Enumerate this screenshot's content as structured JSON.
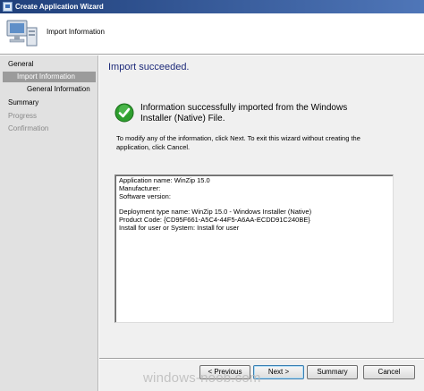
{
  "window": {
    "title": "Create Application Wizard"
  },
  "header": {
    "title": "Import Information"
  },
  "sidebar": {
    "items": [
      {
        "label": "General",
        "state": "normal"
      },
      {
        "label": "Import Information",
        "state": "selected"
      },
      {
        "label": "General Information",
        "state": "normal"
      },
      {
        "label": "Summary",
        "state": "normal"
      },
      {
        "label": "Progress",
        "state": "disabled"
      },
      {
        "label": "Confirmation",
        "state": "disabled"
      }
    ]
  },
  "main": {
    "status_title": "Import succeeded.",
    "success_line1": "Information successfully imported from the Windows",
    "success_line2": "Installer (Native) File.",
    "instructions_line1": "To modify any of the information, click Next. To exit this wizard without creating the",
    "instructions_line2": "application, click Cancel.",
    "details": [
      "Application name: WinZip 15.0",
      "Manufacturer:",
      "Software version:",
      "",
      "Deployment type name: WinZip 15.0 - Windows Installer (Native)",
      "Product Code: {CD95F661-A5C4-44F5-A6AA-ECDD91C240BE}",
      "Install for user or System: Install for user"
    ]
  },
  "buttons": {
    "previous": "< Previous",
    "next": "Next >",
    "summary": "Summary",
    "cancel": "Cancel"
  },
  "watermark": "windows-noob.com",
  "icons": {
    "title_icon": "wizard-icon",
    "header_icon": "computer-icon",
    "status_icon": "green-check-icon"
  },
  "colors": {
    "title_bar": "#2a4f8f",
    "status_title": "#1e2b7a",
    "check_green": "#2e9e2e",
    "selected_nav": "#9b9b9b"
  }
}
